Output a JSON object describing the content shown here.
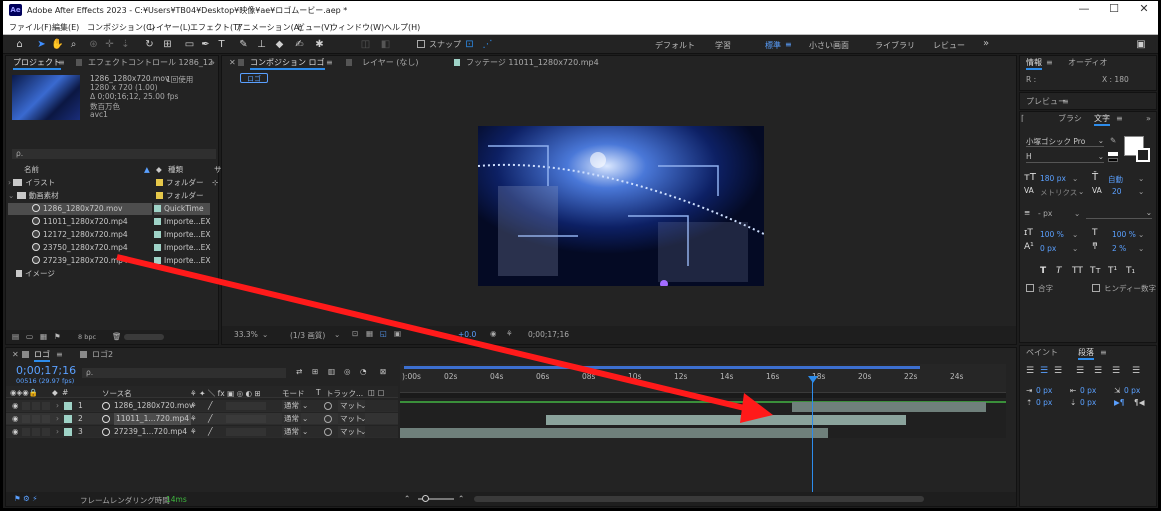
{
  "window": {
    "title": "Adobe After Effects 2023 - C:¥Users¥TB04¥Desktop¥映像¥ae¥ロゴムービー.aep *",
    "logo": "Ae",
    "minimize": "—",
    "maximize": "☐",
    "close": "✕"
  },
  "menu": [
    "ファイル(F)",
    "編集(E)",
    "コンポジション(C)",
    "レイヤー(L)",
    "エフェクト(T)",
    "アニメーション(A)",
    "ビュー(V)",
    "ウィンドウ(W)",
    "ヘルプ(H)"
  ],
  "toolbar": {
    "snap_label": "スナップ",
    "workspaces": [
      "デフォルト",
      "学習",
      "標準",
      "小さい画面",
      "ライブラリ",
      "レビュー"
    ],
    "active_workspace": "標準",
    "more": "»"
  },
  "project": {
    "tab_project": "プロジェクト",
    "tab_effects": "エフェクトコントロール 1286_12",
    "preview": {
      "filename": "1286_1280x720.mov",
      "usage": "1回使用",
      "dims": "1280 x 720 (1.00)",
      "duration": "Δ 0;00;16;12, 25.00 fps",
      "colors": "数百万色",
      "codec": "avc1"
    },
    "search_placeholder": "ρ.",
    "col_name": "名前",
    "col_type": "種類",
    "col_size": "サ",
    "items": [
      {
        "name": "イラスト",
        "type": "フォルダー",
        "kind": "folder",
        "indent": 0
      },
      {
        "name": "動画素材",
        "type": "フォルダー",
        "kind": "folder",
        "indent": 0
      },
      {
        "name": "1286_1280x720.mov",
        "type": "QuickTime",
        "kind": "file",
        "indent": 1,
        "selected": true
      },
      {
        "name": "11011_1280x720.mp4",
        "type": "Importe...EX",
        "kind": "file",
        "indent": 1
      },
      {
        "name": "12172_1280x720.mp4",
        "type": "Importe...EX",
        "kind": "file",
        "indent": 1
      },
      {
        "name": "23750_1280x720.mp4",
        "type": "Importe...EX",
        "kind": "file",
        "indent": 1
      },
      {
        "name": "27239_1280x720.mp4",
        "type": "Importe...EX",
        "kind": "file",
        "indent": 1
      },
      {
        "name": "イメージ",
        "type": "",
        "kind": "folder",
        "indent": 0
      }
    ],
    "bpc": "8 bpc"
  },
  "composition": {
    "tab_comp": "コンポジション ロゴ",
    "tab_layer": "レイヤー (なし)",
    "tab_footage": "フッテージ 11011_1280x720.mp4",
    "breadcrumb": "ロゴ",
    "zoom": "33.3%",
    "quality": "(1/3 画質)",
    "exposure": "+0.0",
    "timecode": "0;00;17;16"
  },
  "info": {
    "tab_info": "情報",
    "tab_audio": "オーディオ",
    "r_label": "R :",
    "x_label": "X : 180"
  },
  "preview_panel": {
    "title": "プレビュー"
  },
  "character": {
    "tab_brush": "ブラシ",
    "tab_char": "文字",
    "font": "小塚ゴシック Pro",
    "style": "H",
    "size": "180 px",
    "leading": "自動",
    "kerning": "メトリクス",
    "tracking": "20",
    "stroke": "- px",
    "vscale": "100 %",
    "hscale": "100 %",
    "baseline": "0 px",
    "tsume": "2 %",
    "styles": [
      "T",
      "T",
      "TT",
      "Tт",
      "T¹",
      "T₁"
    ],
    "ligature": "合字",
    "hindi": "ヒンディー数字"
  },
  "paragraph": {
    "tab_paint": "ペイント",
    "tab_para": "段落",
    "v1": "0 px",
    "v2": "0 px",
    "v3": "0 px",
    "v4": "0 px",
    "v5": "0 px"
  },
  "timeline": {
    "tab1": "ロゴ",
    "tab2": "ロゴ2",
    "timecode": "0;00;17;16",
    "fps": "00516 (29.97 fps)",
    "search_placeholder": "ρ.",
    "col_source": "ソース名",
    "col_mode": "モード",
    "col_t": "T",
    "col_track": "トラック...",
    "ruler": [
      "):00s",
      "02s",
      "04s",
      "06s",
      "08s",
      "10s",
      "12s",
      "14s",
      "16s",
      "18s",
      "20s",
      "22s",
      "24s"
    ],
    "layers": [
      {
        "num": "1",
        "name": "1286_1280x720.mov",
        "mode": "通常",
        "track": "マット"
      },
      {
        "num": "2",
        "name": "11011_1...720.mp4",
        "mode": "通常",
        "track": "マット"
      },
      {
        "num": "3",
        "name": "27239_1...720.mp4",
        "mode": "通常",
        "track": "マット"
      }
    ],
    "render_label": "フレームレンダリング時間",
    "render_value": "14ms"
  },
  "colors": {
    "accent": "#2d8ceb",
    "label_green": "#9fd3c7",
    "label_yellow": "#e6c84a",
    "arrow": "#ff1a1a"
  },
  "icons": [
    "home-icon",
    "selection-tool-icon",
    "hand-tool-icon",
    "zoom-tool-icon",
    "rotate-tool-icon",
    "rectangle-tool-icon",
    "pen-tool-icon",
    "text-tool-icon",
    "brush-tool-icon",
    "stamp-tool-icon",
    "eraser-tool-icon",
    "puppet-tool-icon",
    "eyedropper-icon",
    "search-icon",
    "folder-icon",
    "trash-icon"
  ]
}
